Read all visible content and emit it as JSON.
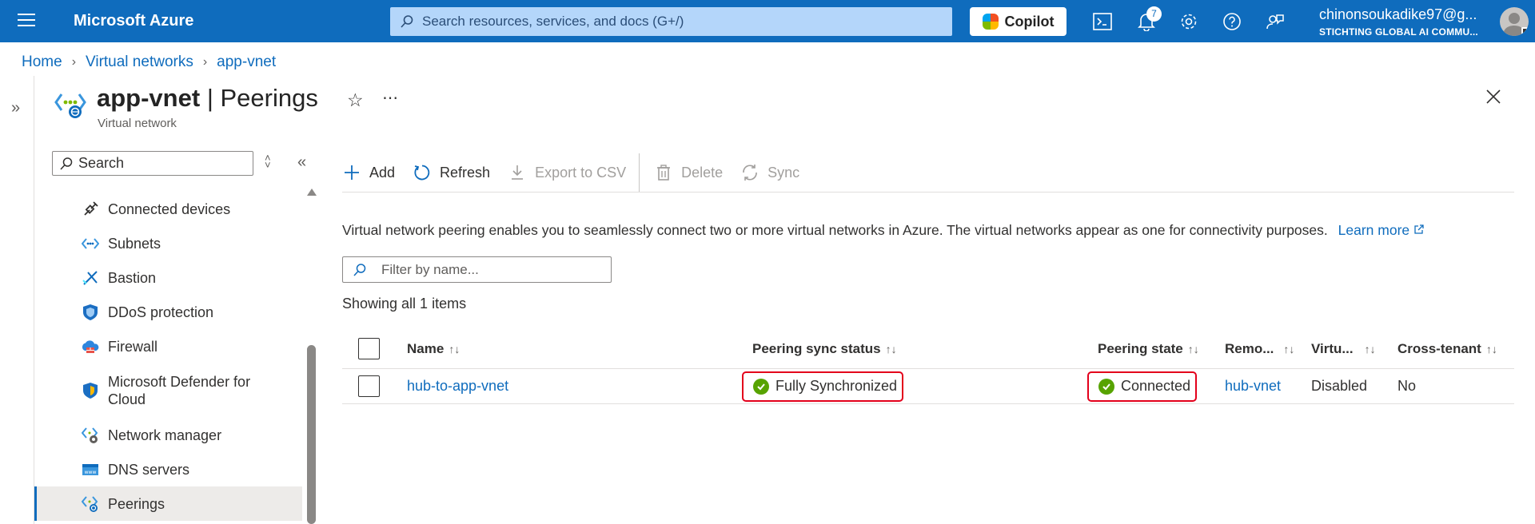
{
  "topbar": {
    "brand": "Microsoft Azure",
    "search_placeholder": "Search resources, services, and docs (G+/)",
    "copilot_label": "Copilot",
    "notifications_count": "7",
    "account_name": "chinonsoukadike97@g...",
    "account_directory": "STICHTING GLOBAL AI COMMU..."
  },
  "breadcrumb": [
    "Home",
    "Virtual networks",
    "app-vnet"
  ],
  "header": {
    "resource_name": "app-vnet",
    "page_name": "Peerings",
    "separator": "|",
    "subtitle": "Virtual network"
  },
  "nav": {
    "search_placeholder": "Search",
    "items": [
      {
        "label": "Connected devices",
        "icon": "connected-devices-icon"
      },
      {
        "label": "Subnets",
        "icon": "subnets-icon"
      },
      {
        "label": "Bastion",
        "icon": "bastion-icon"
      },
      {
        "label": "DDoS protection",
        "icon": "ddos-shield-icon"
      },
      {
        "label": "Firewall",
        "icon": "firewall-icon"
      },
      {
        "label": "Microsoft Defender for Cloud",
        "icon": "defender-shield-icon"
      },
      {
        "label": "Network manager",
        "icon": "network-manager-icon"
      },
      {
        "label": "DNS servers",
        "icon": "dns-servers-icon"
      },
      {
        "label": "Peerings",
        "icon": "peerings-icon",
        "active": true
      }
    ]
  },
  "toolbar": {
    "add": "Add",
    "refresh": "Refresh",
    "export": "Export to CSV",
    "delete": "Delete",
    "sync": "Sync"
  },
  "info": {
    "text": "Virtual network peering enables you to seamlessly connect two or more virtual networks in Azure. The virtual networks appear as one for connectivity purposes.",
    "link": "Learn more"
  },
  "filter": {
    "placeholder": "Filter by name..."
  },
  "count_text": "Showing all 1 items",
  "table": {
    "columns": [
      "Name",
      "Peering sync status",
      "Peering state",
      "Remo...",
      "Virtu...",
      "Cross-tenant"
    ],
    "rows": [
      {
        "name": "hub-to-app-vnet",
        "sync_status": "Fully Synchronized",
        "state": "Connected",
        "remote": "hub-vnet",
        "virtual": "Disabled",
        "cross_tenant": "No"
      }
    ]
  },
  "colors": {
    "accent": "#0f6cbd",
    "success": "#57a300",
    "highlight": "#e3001b"
  }
}
